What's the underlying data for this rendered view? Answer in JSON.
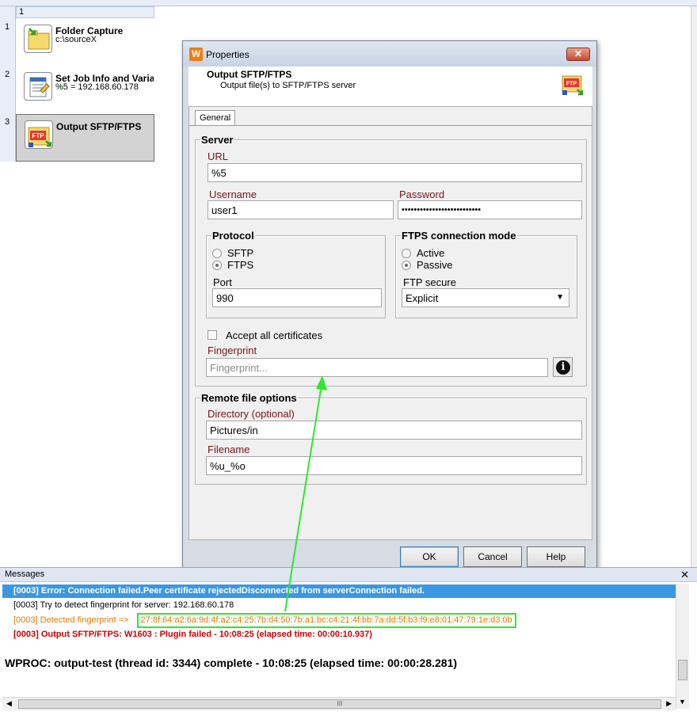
{
  "workflow": {
    "column_header": "1",
    "row_numbers": [
      "1",
      "2",
      "3"
    ],
    "steps": [
      {
        "title": "Folder Capture",
        "subtitle": "c:\\sourceX",
        "icon": "folder-capture-icon"
      },
      {
        "title": "Set Job Info and Varia",
        "subtitle": "%5 = 192.168.60.178",
        "icon": "job-info-icon"
      },
      {
        "title": "Output SFTP/FTPS",
        "subtitle": "",
        "icon": "ftp-output-icon",
        "selected": true
      }
    ]
  },
  "dialog": {
    "app_icon": "W",
    "title": "Properties",
    "close_label": "✕",
    "header_title": "Output SFTP/FTPS",
    "header_subtitle": "Output file(s) to SFTP/FTPS server",
    "header_icon_text": "FTP",
    "tab_general": "General",
    "server": {
      "legend": "Server",
      "url_label": "URL",
      "url_value": "%5",
      "username_label": "Username",
      "username_value": "user1",
      "password_label": "Password",
      "password_value": "••••••••••••••••••••••••••",
      "protocol": {
        "legend": "Protocol",
        "options": [
          "SFTP",
          "FTPS"
        ],
        "selected": "FTPS",
        "port_label": "Port",
        "port_value": "990"
      },
      "ftps_mode": {
        "legend": "FTPS connection mode",
        "options": [
          "Active",
          "Passive"
        ],
        "selected": "Passive",
        "secure_label": "FTP secure",
        "secure_value": "Explicit"
      },
      "accept_certs_label": "Accept all certificates",
      "accept_certs_checked": false,
      "fingerprint_label": "Fingerprint",
      "fingerprint_placeholder": "Fingerprint...",
      "info_icon_text": "i"
    },
    "remote": {
      "legend": "Remote file options",
      "directory_label": "Directory (optional)",
      "directory_value": "Pictures/in",
      "filename_label": "Filename",
      "filename_value": "%u_%o"
    },
    "buttons": {
      "ok": "OK",
      "cancel": "Cancel",
      "help": "Help"
    }
  },
  "messages": {
    "title": "Messages",
    "close_label": "✕",
    "lines": [
      "[0003] Error: Connection failed.Peer certificate rejectedDisconnected from serverConnection failed.",
      "[0003] Try to detect fingerprint for server: 192.168.60.178",
      "[0003] Detected fingerprint =>",
      "[0003] Output SFTP/FTPS: W1603 : Plugin failed - 10:08:25 (elapsed time: 00:00:10.937)",
      "WPROC: output-test (thread id: 3344) complete - 10:08:25 (elapsed time: 00:00:28.281)"
    ],
    "fingerprint_value": "27:8f:64:a2:6a:9d:4f:a2:c4:25:7b:d4:50:7b:a1:bc:c4:21:4f:bb:7a:dd:5f:b3:f9:e8:01:47:79:1e:d3:0b",
    "hscroll_grip": "III"
  },
  "colors": {
    "selection": "#3c97e2",
    "error": "#d00000",
    "warning": "#e27b00",
    "highlight_arrow": "#2ee82e",
    "label_red": "#7a1515"
  }
}
